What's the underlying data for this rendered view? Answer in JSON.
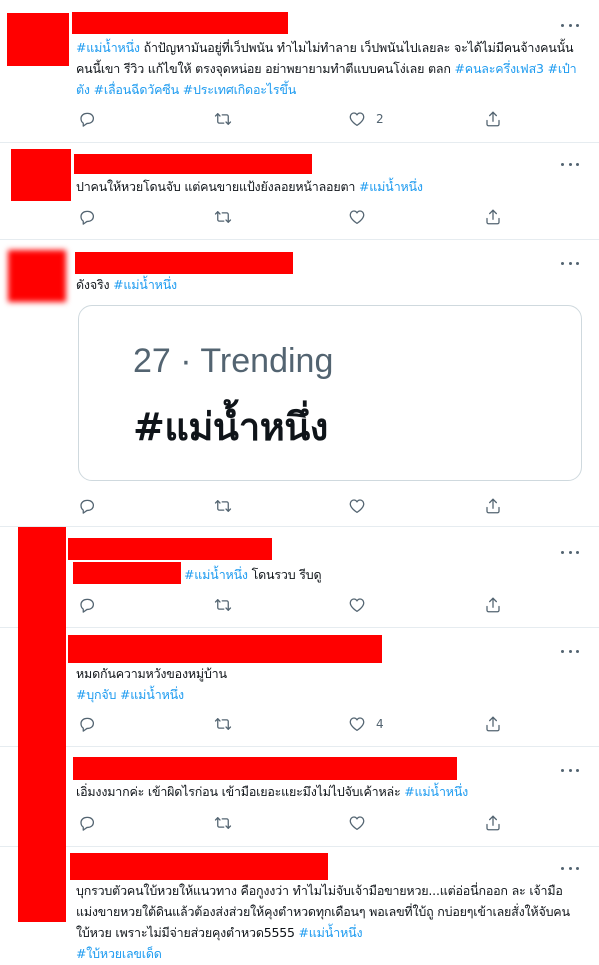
{
  "tweets": [
    {
      "segments": [
        {
          "t": "#แม่น้ำหนึ่ง",
          "tag": true
        },
        {
          "t": " ถ้าปัญหามันอยู่ที่เว็ปพนัน ทำไมไม่ทำลาย เว็ปพนันไปเลยละ จะได้ไม่มีคนจ้างคนนั้นคนนี้เขา รีวิว แก้ไขให้ ตรงจุดหน่อย อย่าพยายามทำตีแบบคนโง่เลย ตลก ",
          "tag": false
        },
        {
          "t": "#คนละครึ่งเฟส3",
          "tag": true
        },
        {
          "t": " ",
          "tag": false
        },
        {
          "t": "#เป๋าตัง",
          "tag": true
        },
        {
          "t": " ",
          "tag": false
        },
        {
          "t": "#เลื่อนฉีดวัคซีน",
          "tag": true
        },
        {
          "t": " ",
          "tag": false
        },
        {
          "t": "#ประเทศเกิดอะไรขึ้น",
          "tag": true
        }
      ],
      "likes": "2"
    },
    {
      "segments": [
        {
          "t": "ปาคนให้หวยโดนจับ แต่คนขายแป้งยังลอยหน้าลอยตา ",
          "tag": false
        },
        {
          "t": "#แม่น้ำหนึ่ง",
          "tag": true
        }
      ],
      "likes": ""
    },
    {
      "segments": [
        {
          "t": "ดังจริง ",
          "tag": false
        },
        {
          "t": "#แม่น้ำหนึ่ง",
          "tag": true
        }
      ],
      "card": {
        "rank": "27 · Trending",
        "trend": "#แม่น้ำหนึ่ง"
      },
      "likes": ""
    },
    {
      "segments": [
        {
          "t": "#แม่น้ำหนึ่ง",
          "tag": true
        },
        {
          "t": " โดนรวบ รีบดู",
          "tag": false
        }
      ],
      "likes": ""
    },
    {
      "segments": [
        {
          "t": "หมดกันความหวังของหมู่บ้าน\n",
          "tag": false
        },
        {
          "t": "#บุกจับ",
          "tag": true
        },
        {
          "t": " ",
          "tag": false
        },
        {
          "t": "#แม่น้ำหนึ่ง",
          "tag": true
        }
      ],
      "likes": "4"
    },
    {
      "segments": [
        {
          "t": "เอิ่มงงมากค่ะ เข้าผิดไรก่อน เข้ามือเยอะแยะมึงไม่ไปจับเค้าหล่ะ ",
          "tag": false
        },
        {
          "t": "#แม่น้ำหนึ่ง",
          "tag": true
        }
      ],
      "likes": ""
    },
    {
      "segments": [
        {
          "t": "บุกรวบตัวคนใบ้หวยให้แนวทาง คือกูงงว่า ทำไมไม่จับเจ้ามือขายหวย...แต่อ่อนี่กออก ละ เจ้ามือแม่งขายหวยใต้ดินแล้วต้องส่งส่วยให้คุงตำหวดทุกเดือนๆ พอเลขที่ใบ้ถู กบ่อยๆเข้าเลยสั่งให้จับคนใบ้หวย เพราะไม่มีจ่ายส่วยคุงตำหวด5555 ",
          "tag": false
        },
        {
          "t": "#แม่น้ำหนึ่ง",
          "tag": true
        },
        {
          "t": "\n",
          "tag": false
        },
        {
          "t": "#ใบ้หวยเลขเด็ด",
          "tag": true
        }
      ],
      "likes": ""
    }
  ],
  "icons": {
    "reply": "reply-icon",
    "retweet": "retweet-icon",
    "like": "heart-icon",
    "share": "share-icon",
    "more": "more-icon"
  },
  "colors": {
    "hashtag": "#1d9bf0",
    "redaction": "#ff0000",
    "muted": "#536471"
  }
}
